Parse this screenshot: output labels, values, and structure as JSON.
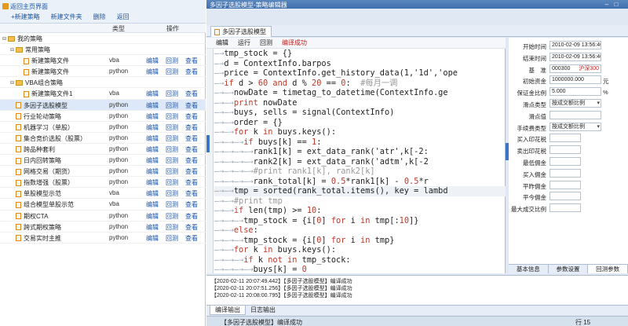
{
  "left": {
    "back_label": "返回主页界面",
    "actions": [
      "+新建策略",
      "新建文件夹",
      "删除",
      "返回"
    ],
    "columns": [
      "类型",
      "操作"
    ],
    "tree": [
      {
        "name": "我的策略",
        "indent": 0,
        "toggle": "⊟",
        "folder": true,
        "type": "",
        "actions": []
      },
      {
        "name": "常用策略",
        "indent": 1,
        "toggle": "⊟",
        "folder": true,
        "type": "",
        "actions": []
      },
      {
        "name": "新建策略文件",
        "indent": 2,
        "toggle": "",
        "folder": false,
        "type": "vba",
        "actions": [
          "编辑",
          "回测",
          "查看"
        ]
      },
      {
        "name": "新建策略文件",
        "indent": 2,
        "toggle": "",
        "folder": false,
        "type": "python",
        "actions": [
          "编辑",
          "回测",
          "查看"
        ]
      },
      {
        "name": "VBA组合策略",
        "indent": 1,
        "toggle": "⊟",
        "folder": true,
        "type": "",
        "actions": []
      },
      {
        "name": "新建策略文件1",
        "indent": 2,
        "toggle": "",
        "folder": false,
        "type": "vba",
        "actions": [
          "编辑",
          "回测",
          "查看"
        ]
      },
      {
        "name": "多因子选股模型",
        "indent": 1,
        "toggle": "",
        "folder": false,
        "type": "python",
        "actions": [
          "编辑",
          "回测",
          "查看"
        ],
        "selected": true
      },
      {
        "name": "行业轮动策略",
        "indent": 1,
        "toggle": "",
        "folder": false,
        "type": "python",
        "actions": [
          "编辑",
          "回测",
          "查看"
        ]
      },
      {
        "name": "机器学习（单股）",
        "indent": 1,
        "toggle": "",
        "folder": false,
        "type": "python",
        "actions": [
          "编辑",
          "回测",
          "查看"
        ]
      },
      {
        "name": "集合竞价选股（股票）",
        "indent": 1,
        "toggle": "",
        "folder": false,
        "type": "python",
        "actions": [
          "编辑",
          "回测",
          "查看"
        ]
      },
      {
        "name": "跨品种套利",
        "indent": 1,
        "toggle": "",
        "folder": false,
        "type": "python",
        "actions": [
          "编辑",
          "回测",
          "查看"
        ]
      },
      {
        "name": "日内回转策略",
        "indent": 1,
        "toggle": "",
        "folder": false,
        "type": "python",
        "actions": [
          "编辑",
          "回测",
          "查看"
        ]
      },
      {
        "name": "网格交易（期货）",
        "indent": 1,
        "toggle": "",
        "folder": false,
        "type": "python",
        "actions": [
          "编辑",
          "回测",
          "查看"
        ]
      },
      {
        "name": "指数增强（股票）",
        "indent": 1,
        "toggle": "",
        "folder": false,
        "type": "python",
        "actions": [
          "编辑",
          "回测",
          "查看"
        ]
      },
      {
        "name": "单股模型示范",
        "indent": 1,
        "toggle": "",
        "folder": false,
        "type": "vba",
        "actions": [
          "编辑",
          "回测",
          "查看"
        ]
      },
      {
        "name": "组合模型单股示范",
        "indent": 1,
        "toggle": "",
        "folder": false,
        "type": "vba",
        "actions": [
          "编辑",
          "回测",
          "查看"
        ]
      },
      {
        "name": "期权CTA",
        "indent": 1,
        "toggle": "",
        "folder": false,
        "type": "python",
        "actions": [
          "编辑",
          "回测",
          "查看"
        ]
      },
      {
        "name": "跨式期权策略",
        "indent": 1,
        "toggle": "",
        "folder": false,
        "type": "python",
        "actions": [
          "编辑",
          "回测",
          "查看"
        ]
      },
      {
        "name": "交易实时主推",
        "indent": 1,
        "toggle": "",
        "folder": false,
        "type": "python",
        "actions": [
          "编辑",
          "回测",
          "查看"
        ]
      }
    ]
  },
  "window": {
    "title": "多因子选股模型-策略编辑器",
    "tab": "多因子选股模型",
    "toolbar": [
      "编辑",
      "运行",
      "回测"
    ],
    "compile_status": "编译成功"
  },
  "code_lines": [
    {
      "d": 1,
      "t": [
        [
          "",
          "tmp_stock = {}"
        ]
      ]
    },
    {
      "d": 1,
      "t": [
        [
          "",
          "d = ContextInfo.barpos"
        ]
      ]
    },
    {
      "d": 1,
      "t": [
        [
          "",
          "price = ContextInfo.get_history_data(1,'1d','ope"
        ]
      ]
    },
    {
      "d": 1,
      "t": [
        [
          "kw",
          "if "
        ],
        [
          "",
          "d > "
        ],
        [
          "num",
          "60"
        ],
        [
          "kw",
          " and "
        ],
        [
          "",
          "d % "
        ],
        [
          "num",
          "20"
        ],
        [
          "",
          " == "
        ],
        [
          "num",
          "0"
        ],
        [
          "",
          ":  "
        ],
        [
          "cm",
          "#每月一调"
        ]
      ],
      "fold": "⊟"
    },
    {
      "d": 2,
      "t": [
        [
          "",
          "nowDate = timetag_to_datetime(ContextInfo.ge"
        ]
      ]
    },
    {
      "d": 2,
      "t": [
        [
          "kw",
          "print "
        ],
        [
          "",
          "nowDate"
        ]
      ]
    },
    {
      "d": 2,
      "t": [
        [
          "",
          "buys, sells = signal(ContextInfo)"
        ]
      ]
    },
    {
      "d": 2,
      "t": [
        [
          "",
          "order = {}"
        ]
      ]
    },
    {
      "d": 2,
      "t": [
        [
          "kw",
          "for "
        ],
        [
          "",
          "k "
        ],
        [
          "kw",
          "in "
        ],
        [
          "",
          "buys.keys():"
        ]
      ],
      "fold": "⊟"
    },
    {
      "d": 3,
      "t": [
        [
          "kw",
          "if "
        ],
        [
          "",
          "buys[k] == "
        ],
        [
          "num",
          "1"
        ],
        [
          "",
          ":"
        ]
      ],
      "fold": "⊟"
    },
    {
      "d": 4,
      "t": [
        [
          "",
          "rank1[k] = ext_data_rank('atr',k[-2:"
        ]
      ]
    },
    {
      "d": 4,
      "t": [
        [
          "",
          "rank2[k] = ext_data_rank('adtm',k[-2"
        ]
      ]
    },
    {
      "d": 4,
      "t": [
        [
          "cm",
          "#print rank1[k], rank2[k]"
        ]
      ]
    },
    {
      "d": 4,
      "t": [
        [
          "",
          "rank_total[k] = "
        ],
        [
          "num",
          "0.5"
        ],
        [
          "",
          "*rank1[k] - "
        ],
        [
          "num",
          "0.5"
        ],
        [
          "",
          "*r"
        ]
      ]
    },
    {
      "d": 2,
      "t": [
        [
          "",
          "tmp = sorted(rank_total.items(), key = lambd"
        ]
      ]
    },
    {
      "d": 2,
      "t": [
        [
          "cm",
          "#print tmp"
        ]
      ]
    },
    {
      "d": 2,
      "t": [
        [
          "kw",
          "if "
        ],
        [
          "",
          "len(tmp) >= "
        ],
        [
          "num",
          "10"
        ],
        [
          "",
          ":"
        ]
      ],
      "fold": "⊟"
    },
    {
      "d": 3,
      "t": [
        [
          "",
          "tmp_stock = {i["
        ],
        [
          "num",
          "0"
        ],
        [
          "",
          "] "
        ],
        [
          "kw",
          "for "
        ],
        [
          "",
          "i "
        ],
        [
          "kw",
          "in "
        ],
        [
          "",
          "tmp[:"
        ],
        [
          "num",
          "10"
        ],
        [
          "",
          "]}"
        ]
      ]
    },
    {
      "d": 2,
      "t": [
        [
          "kw",
          "else"
        ],
        [
          "",
          ":"
        ]
      ],
      "fold": "⊟"
    },
    {
      "d": 3,
      "t": [
        [
          "",
          "tmp_stock = {i["
        ],
        [
          "num",
          "0"
        ],
        [
          "",
          "] "
        ],
        [
          "kw",
          "for "
        ],
        [
          "",
          "i "
        ],
        [
          "kw",
          "in "
        ],
        [
          "",
          "tmp}"
        ]
      ]
    },
    {
      "d": 2,
      "t": [
        [
          "kw",
          "for "
        ],
        [
          "",
          "k "
        ],
        [
          "kw",
          "in "
        ],
        [
          "",
          "buys.keys():"
        ]
      ],
      "fold": "⊟"
    },
    {
      "d": 3,
      "t": [
        [
          "kw",
          "if "
        ],
        [
          "",
          "k "
        ],
        [
          "kw",
          "not in "
        ],
        [
          "",
          "tmp_stock:"
        ]
      ]
    },
    {
      "d": 4,
      "t": [
        [
          "",
          "buys[k] = "
        ],
        [
          "num",
          "0"
        ]
      ]
    }
  ],
  "params": {
    "rows": [
      {
        "label": "开始时间",
        "value": "2010-02-09 13:56:46",
        "kind": "sel"
      },
      {
        "label": "结束时间",
        "value": "2010-02-09 13:56:46",
        "kind": "sel"
      },
      {
        "label": "基　准",
        "value": "000300",
        "kind": "sel",
        "extra": "沪深300"
      },
      {
        "label": "初始资金",
        "value": "1000000.000",
        "kind": "sel",
        "unit": "元"
      },
      {
        "label": "保证金比例",
        "value": "5.000",
        "kind": "sel",
        "unit": "%"
      },
      {
        "label": "滑点类型",
        "value": "按成交额比例",
        "kind": "dd"
      },
      {
        "label": "滑点值",
        "value": "",
        "kind": "sel"
      },
      {
        "label": "手续费类型",
        "value": "按成交额比例",
        "kind": "dd"
      },
      {
        "label": "买入印花税",
        "value": "",
        "kind": "short"
      },
      {
        "label": "卖出印花税",
        "value": "",
        "kind": "short"
      },
      {
        "label": "最低佣金",
        "value": "",
        "kind": "short"
      },
      {
        "label": "买入佣金",
        "value": "",
        "kind": "short"
      },
      {
        "label": "平昨佣金",
        "value": "",
        "kind": "short"
      },
      {
        "label": "平今佣金",
        "value": "",
        "kind": "short"
      },
      {
        "label": "最大成交比例",
        "value": "",
        "kind": "short"
      }
    ],
    "tabs": [
      "基本信息",
      "参数设置",
      "回测参数"
    ],
    "active_tab": 2
  },
  "output": {
    "lines": [
      "【2020-02-11 20:07:49.442】【多因子选股模型】编译成功",
      "【2020-02-11 20:07:51.256】【多因子选股模型】编译成功",
      "【2020-02-11 20:08:00.795】【多因子选股模型】编译成功"
    ],
    "tabs": [
      "编译输出",
      "日志输出"
    ]
  },
  "status": {
    "message": "【多因子选股模型】编译成功",
    "cursor": "行 15"
  }
}
